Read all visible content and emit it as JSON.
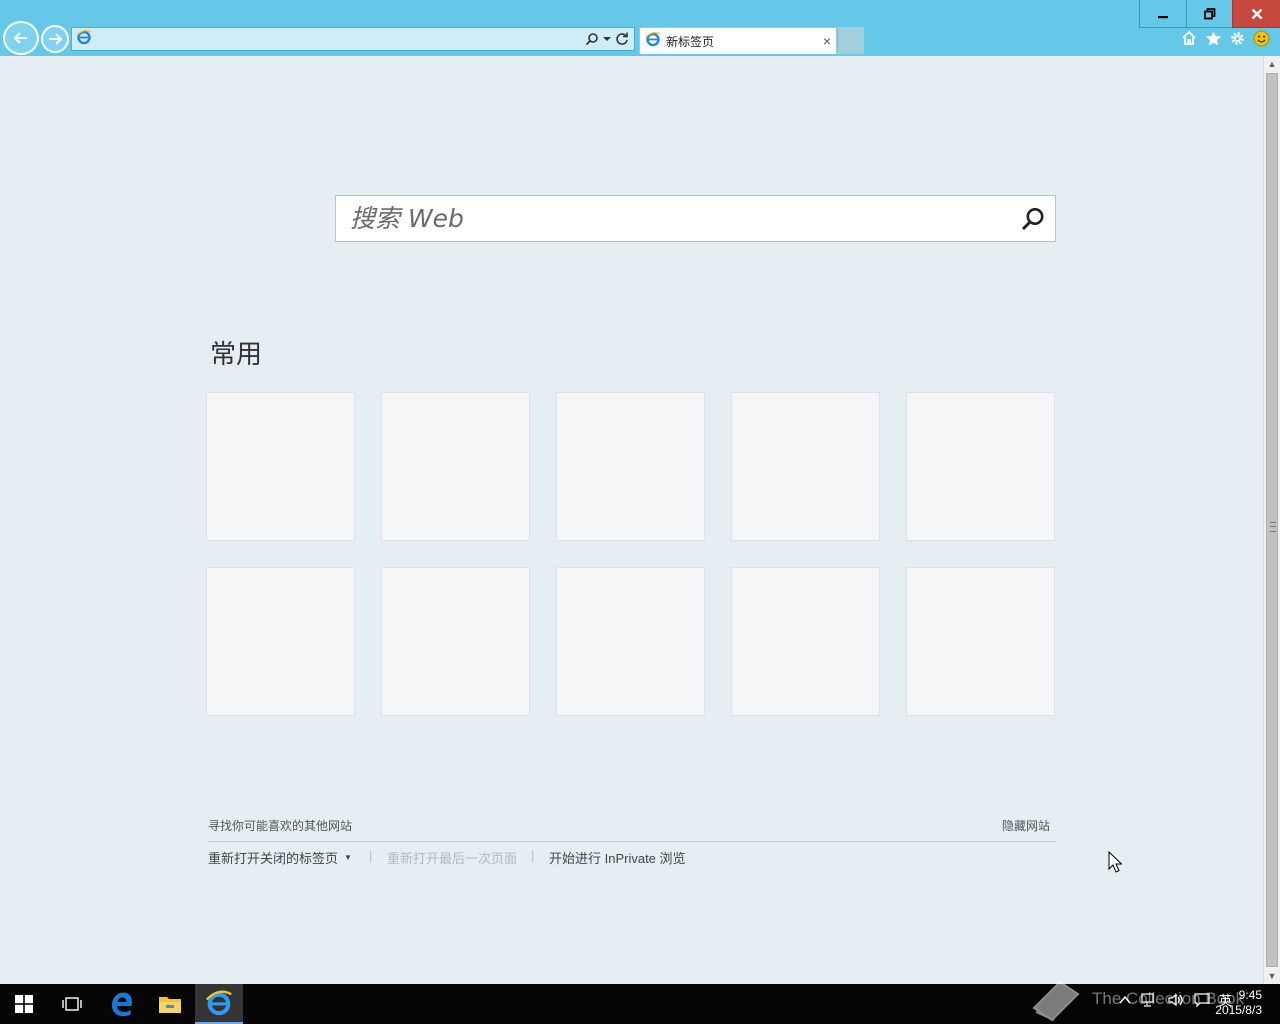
{
  "browser": {
    "address_value": "",
    "tab_title": "新标签页",
    "tab_close": "×",
    "colors": {
      "title_bar": "#65c8e8",
      "close_button": "#c7493e",
      "page_background": "#e4eef3"
    }
  },
  "window_controls": {
    "minimize": "minimize-icon",
    "restore": "restore-icon",
    "close": "close-icon"
  },
  "search": {
    "placeholder": "搜索 Web"
  },
  "frequent": {
    "title": "常用",
    "tiles": [
      {},
      {},
      {},
      {},
      {},
      {},
      {},
      {},
      {},
      {}
    ]
  },
  "footer": {
    "find_sites": "寻找你可能喜欢的其他网站",
    "hide_sites": "隐藏网站",
    "reopen_closed_tabs": "重新打开关闭的标签页",
    "reopen_last_session": "重新打开最后一次页面",
    "inprivate": "开始进行 InPrivate 浏览",
    "separator": "|"
  },
  "taskbar": {
    "input_indicator": "英",
    "time": "9:45",
    "date": "2015/8/3",
    "watermark": "The Collection Book"
  }
}
